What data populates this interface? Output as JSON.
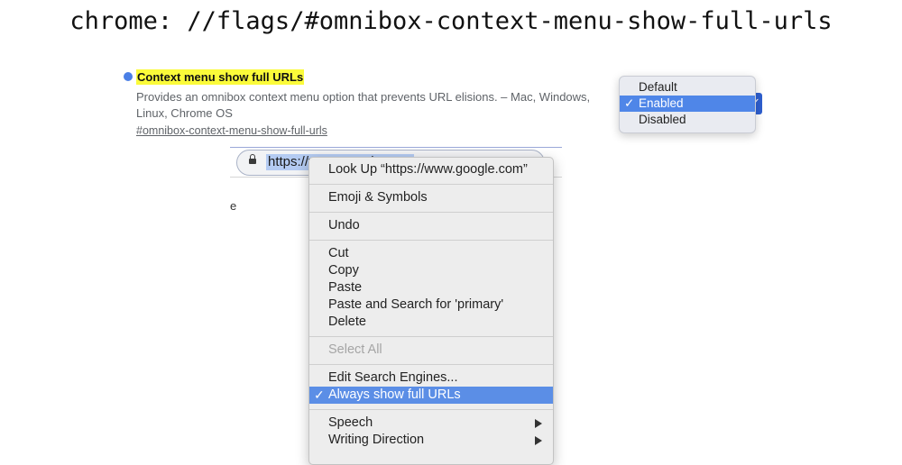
{
  "headline": "chrome: //flags/#omnibox-context-menu-show-full-urls",
  "flag": {
    "title": "Context menu show full URLs",
    "description": "Provides an omnibox context menu option that prevents URL elisions. – Mac, Windows, Linux, Chrome OS",
    "link": "#omnibox-context-menu-show-full-urls"
  },
  "omnibox": {
    "url_visible": "https://www.google.com"
  },
  "stray_text": "e",
  "dropdown": {
    "options": [
      {
        "label": "Default",
        "selected": false
      },
      {
        "label": "Enabled",
        "selected": true
      },
      {
        "label": "Disabled",
        "selected": false
      }
    ],
    "check_mark": "✓"
  },
  "context_menu": {
    "items": [
      {
        "label": "Look Up “https://www.google.com”"
      },
      {
        "label": "Emoji & Symbols"
      },
      {
        "label": "Undo"
      },
      {
        "label": "Cut"
      },
      {
        "label": "Copy"
      },
      {
        "label": "Paste"
      },
      {
        "label": "Paste and Search for 'primary'"
      },
      {
        "label": "Delete"
      },
      {
        "label": "Select All",
        "disabled": true
      },
      {
        "label": "Edit Search Engines..."
      },
      {
        "label": "Always show full URLs",
        "checked": true,
        "highlighted": true
      },
      {
        "label": "Speech",
        "submenu": true
      },
      {
        "label": "Writing Direction",
        "submenu": true
      }
    ],
    "check_mark": "✓"
  },
  "colors": {
    "highlight": "#fbfb3a",
    "menu_highlight": "#5b8ee6",
    "dropdown_selected": "#4f86e8",
    "bullet": "#4a7fe6"
  }
}
